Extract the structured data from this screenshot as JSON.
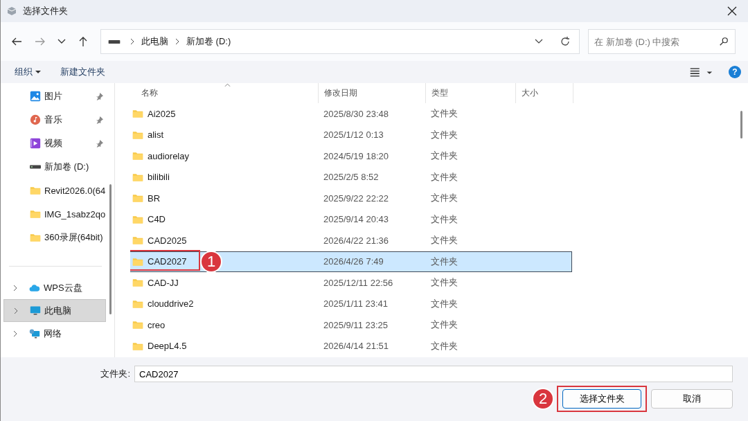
{
  "window": {
    "title": "选择文件夹"
  },
  "nav": {
    "breadcrumbs": [
      "此电脑",
      "新加卷 (D:)"
    ],
    "search": {
      "placeholder": "在 新加卷 (D:) 中搜索"
    }
  },
  "commands": [
    {
      "label": "组织",
      "dropdown": true
    },
    {
      "label": "新建文件夹",
      "dropdown": false
    }
  ],
  "help": {
    "label": "?"
  },
  "sidebar": {
    "items": [
      {
        "label": "图片",
        "kind": "pictures",
        "pinned": true,
        "expandable": false,
        "selected": false
      },
      {
        "label": "音乐",
        "kind": "music",
        "pinned": true,
        "expandable": false,
        "selected": false
      },
      {
        "label": "视频",
        "kind": "video",
        "pinned": true,
        "expandable": false,
        "selected": false
      },
      {
        "label": "新加卷 (D:)",
        "kind": "drive",
        "pinned": false,
        "expandable": false,
        "selected": false
      },
      {
        "label": "Revit2026.0(64",
        "kind": "folder",
        "pinned": false,
        "expandable": false,
        "selected": false
      },
      {
        "label": "IMG_1sabz2qo",
        "kind": "folder",
        "pinned": false,
        "expandable": false,
        "selected": false
      },
      {
        "label": "360录屏(64bit)",
        "kind": "folder",
        "pinned": false,
        "expandable": false,
        "selected": false
      },
      {
        "label": "WPS云盘",
        "kind": "cloud",
        "pinned": false,
        "expandable": true,
        "selected": false
      },
      {
        "label": "此电脑",
        "kind": "pc",
        "pinned": false,
        "expandable": true,
        "selected": true
      },
      {
        "label": "网络",
        "kind": "network",
        "pinned": false,
        "expandable": true,
        "selected": false
      }
    ]
  },
  "table": {
    "columns": [
      {
        "label": "名称",
        "sorted": true
      },
      {
        "label": "修改日期",
        "sorted": false
      },
      {
        "label": "类型",
        "sorted": false
      },
      {
        "label": "大小",
        "sorted": false
      }
    ],
    "rows": [
      {
        "name": "Ai2025",
        "date": "2025/8/30 23:48",
        "type": "文件夹",
        "selected": false
      },
      {
        "name": "alist",
        "date": "2025/1/12 0:13",
        "type": "文件夹",
        "selected": false
      },
      {
        "name": "audiorelay",
        "date": "2024/5/19 18:20",
        "type": "文件夹",
        "selected": false
      },
      {
        "name": "bilibili",
        "date": "2025/2/5 8:52",
        "type": "文件夹",
        "selected": false
      },
      {
        "name": "BR",
        "date": "2025/9/22 22:22",
        "type": "文件夹",
        "selected": false
      },
      {
        "name": "C4D",
        "date": "2025/9/14 20:43",
        "type": "文件夹",
        "selected": false
      },
      {
        "name": "CAD2025",
        "date": "2026/4/22 21:36",
        "type": "文件夹",
        "selected": false
      },
      {
        "name": "CAD2027",
        "date": "2026/4/26 7:49",
        "type": "文件夹",
        "selected": true,
        "callout": "1"
      },
      {
        "name": "CAD-JJ",
        "date": "2025/12/11 22:56",
        "type": "文件夹",
        "selected": false
      },
      {
        "name": "clouddrive2",
        "date": "2025/1/11 23:41",
        "type": "文件夹",
        "selected": false
      },
      {
        "name": "creo",
        "date": "2025/9/11 23:25",
        "type": "文件夹",
        "selected": false
      },
      {
        "name": "DeepL4.5",
        "date": "2026/4/14 21:51",
        "type": "文件夹",
        "selected": false
      }
    ]
  },
  "folder_field": {
    "label": "文件夹:",
    "value": "CAD2027"
  },
  "buttons": [
    {
      "label": "选择文件夹",
      "kind": "primary",
      "callout": "2"
    },
    {
      "label": "取消",
      "kind": "secondary"
    }
  ]
}
